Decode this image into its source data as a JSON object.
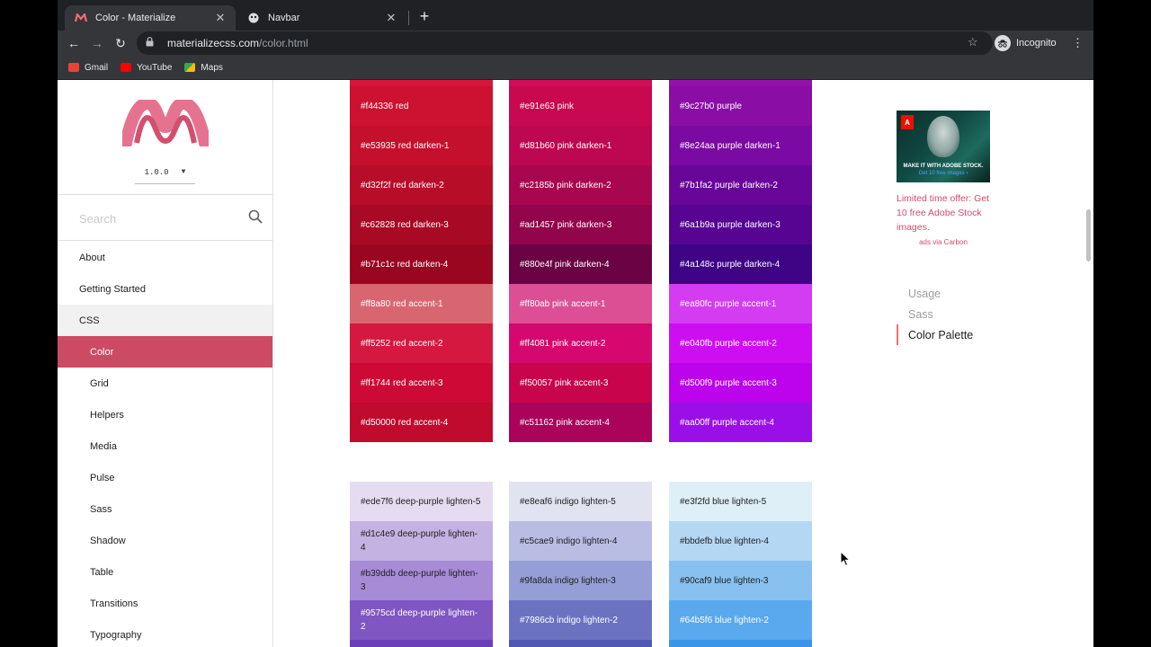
{
  "browser": {
    "tabs": [
      {
        "title": "Color - Materialize",
        "active": true
      },
      {
        "title": "Navbar",
        "active": false
      }
    ],
    "url_host": "materializecss.com",
    "url_path": "/color.html",
    "profile_label": "Incognito",
    "bookmarks": [
      {
        "label": "Gmail",
        "icon": "gmail-icon",
        "color": "#ea4335"
      },
      {
        "label": "YouTube",
        "icon": "youtube-icon",
        "color": "#ff0000"
      },
      {
        "label": "Maps",
        "icon": "maps-icon",
        "color": "#34a853"
      }
    ]
  },
  "sidebar": {
    "version": "1.0.0",
    "search_placeholder": "Search",
    "items": [
      {
        "label": "About",
        "level": "top"
      },
      {
        "label": "Getting Started",
        "level": "top"
      },
      {
        "label": "CSS",
        "level": "top",
        "expanded": true
      },
      {
        "label": "Color",
        "level": "sub",
        "active": true
      },
      {
        "label": "Grid",
        "level": "sub"
      },
      {
        "label": "Helpers",
        "level": "sub"
      },
      {
        "label": "Media",
        "level": "sub"
      },
      {
        "label": "Pulse",
        "level": "sub"
      },
      {
        "label": "Sass",
        "level": "sub"
      },
      {
        "label": "Shadow",
        "level": "sub"
      },
      {
        "label": "Table",
        "level": "sub"
      },
      {
        "label": "Transitions",
        "level": "sub"
      },
      {
        "label": "Typography",
        "level": "sub"
      }
    ]
  },
  "palette_top": [
    {
      "name": "red",
      "swatches": [
        {
          "label": "#f44336 red",
          "bg": "#cc1230",
          "fg": "#ffffff"
        },
        {
          "label": "#e53935 red darken-1",
          "bg": "#c4102c",
          "fg": "#ffffff"
        },
        {
          "label": "#d32f2f red darken-2",
          "bg": "#b80d29",
          "fg": "#ffffff"
        },
        {
          "label": "#c62828 red darken-3",
          "bg": "#a80a26",
          "fg": "#ffffff"
        },
        {
          "label": "#b71c1c red darken-4",
          "bg": "#9a0520",
          "fg": "#ffffff"
        },
        {
          "label": "#ff8a80 red accent-1",
          "bg": "#d86670",
          "fg": "#ffffff"
        },
        {
          "label": "#ff5252 red accent-2",
          "bg": "#d4183f",
          "fg": "#ffffff"
        },
        {
          "label": "#ff1744 red accent-3",
          "bg": "#cd0a36",
          "fg": "#ffffff"
        },
        {
          "label": "#d50000 red accent-4",
          "bg": "#c00a2e",
          "fg": "#ffffff"
        }
      ]
    },
    {
      "name": "pink",
      "swatches": [
        {
          "label": "#e91e63 pink",
          "bg": "#c8084f",
          "fg": "#ffffff"
        },
        {
          "label": "#d81b60 pink darken-1",
          "bg": "#bd0750",
          "fg": "#ffffff"
        },
        {
          "label": "#c2185b pink darken-2",
          "bg": "#a90650",
          "fg": "#ffffff"
        },
        {
          "label": "#ad1457 pink darken-3",
          "bg": "#92044c",
          "fg": "#ffffff"
        },
        {
          "label": "#880e4f pink darken-4",
          "bg": "#6a0243",
          "fg": "#ffffff"
        },
        {
          "label": "#ff80ab pink accent-1",
          "bg": "#dc4f95",
          "fg": "#ffffff"
        },
        {
          "label": "#ff4081 pink accent-2",
          "bg": "#d4086e",
          "fg": "#ffffff"
        },
        {
          "label": "#f50057 pink accent-3",
          "bg": "#c7044c",
          "fg": "#ffffff"
        },
        {
          "label": "#c51162 pink accent-4",
          "bg": "#a9045a",
          "fg": "#ffffff"
        }
      ]
    },
    {
      "name": "purple",
      "swatches": [
        {
          "label": "#9c27b0 purple",
          "bg": "#8a0ea6",
          "fg": "#ffffff"
        },
        {
          "label": "#8e24aa purple darken-1",
          "bg": "#7b09a3",
          "fg": "#ffffff"
        },
        {
          "label": "#7b1fa2 purple darken-2",
          "bg": "#680699",
          "fg": "#ffffff"
        },
        {
          "label": "#6a1b9a purple darken-3",
          "bg": "#570492",
          "fg": "#ffffff"
        },
        {
          "label": "#4a148c purple darken-4",
          "bg": "#3e0485",
          "fg": "#ffffff"
        },
        {
          "label": "#ea80fc purple accent-1",
          "bg": "#d33cf0",
          "fg": "#ffffff"
        },
        {
          "label": "#e040fb purple accent-2",
          "bg": "#cc0ef0",
          "fg": "#ffffff"
        },
        {
          "label": "#d500f9 purple accent-3",
          "bg": "#bc03ec",
          "fg": "#ffffff"
        },
        {
          "label": "#aa00ff purple accent-4",
          "bg": "#9a0fe8",
          "fg": "#ffffff"
        }
      ]
    }
  ],
  "palette_bottom": [
    {
      "name": "deep-purple",
      "swatches": [
        {
          "label": "#ede7f6 deep-purple lighten-5",
          "bg": "#e5dcf1",
          "fg": "#212121"
        },
        {
          "label": "#d1c4e9 deep-purple lighten-4",
          "bg": "#c3b2e2",
          "fg": "#212121"
        },
        {
          "label": "#b39ddb deep-purple lighten-3",
          "bg": "#a78bd6",
          "fg": "#212121"
        },
        {
          "label": "#9575cd deep-purple lighten-2",
          "bg": "#7f56c2",
          "fg": "#ffffff"
        },
        {
          "label": "",
          "bg": "#6a3fb8",
          "fg": "#ffffff"
        }
      ]
    },
    {
      "name": "indigo",
      "swatches": [
        {
          "label": "#e8eaf6 indigo lighten-5",
          "bg": "#e2e3f1",
          "fg": "#212121"
        },
        {
          "label": "#c5cae9 indigo lighten-4",
          "bg": "#b9bde3",
          "fg": "#212121"
        },
        {
          "label": "#9fa8da indigo lighten-3",
          "bg": "#959ed6",
          "fg": "#212121"
        },
        {
          "label": "#7986cb indigo lighten-2",
          "bg": "#6b73c1",
          "fg": "#ffffff"
        },
        {
          "label": "",
          "bg": "#5058b4",
          "fg": "#ffffff"
        }
      ]
    },
    {
      "name": "blue",
      "swatches": [
        {
          "label": "#e3f2fd blue lighten-5",
          "bg": "#dfeff8",
          "fg": "#212121"
        },
        {
          "label": "#bbdefb blue lighten-4",
          "bg": "#b4d8f4",
          "fg": "#212121"
        },
        {
          "label": "#90caf9 blue lighten-3",
          "bg": "#88c1f0",
          "fg": "#212121"
        },
        {
          "label": "#64b5f6 blue lighten-2",
          "bg": "#5aa8ee",
          "fg": "#ffffff"
        },
        {
          "label": "",
          "bg": "#3a95e8",
          "fg": "#ffffff"
        }
      ]
    }
  ],
  "ad": {
    "image_caption": "MAKE IT WITH ADOBE STOCK.",
    "image_subcaption": "Get 10 free images ›",
    "text": "Limited time offer: Get 10 free Adobe Stock images.",
    "via": "ads via Carbon"
  },
  "toc": [
    {
      "label": "Usage",
      "active": false
    },
    {
      "label": "Sass",
      "active": false
    },
    {
      "label": "Color Palette",
      "active": true
    }
  ],
  "colors": {
    "accent": "#cc4a64",
    "ad_text": "#d64a6a",
    "toc_marker": "#ee6e73"
  }
}
